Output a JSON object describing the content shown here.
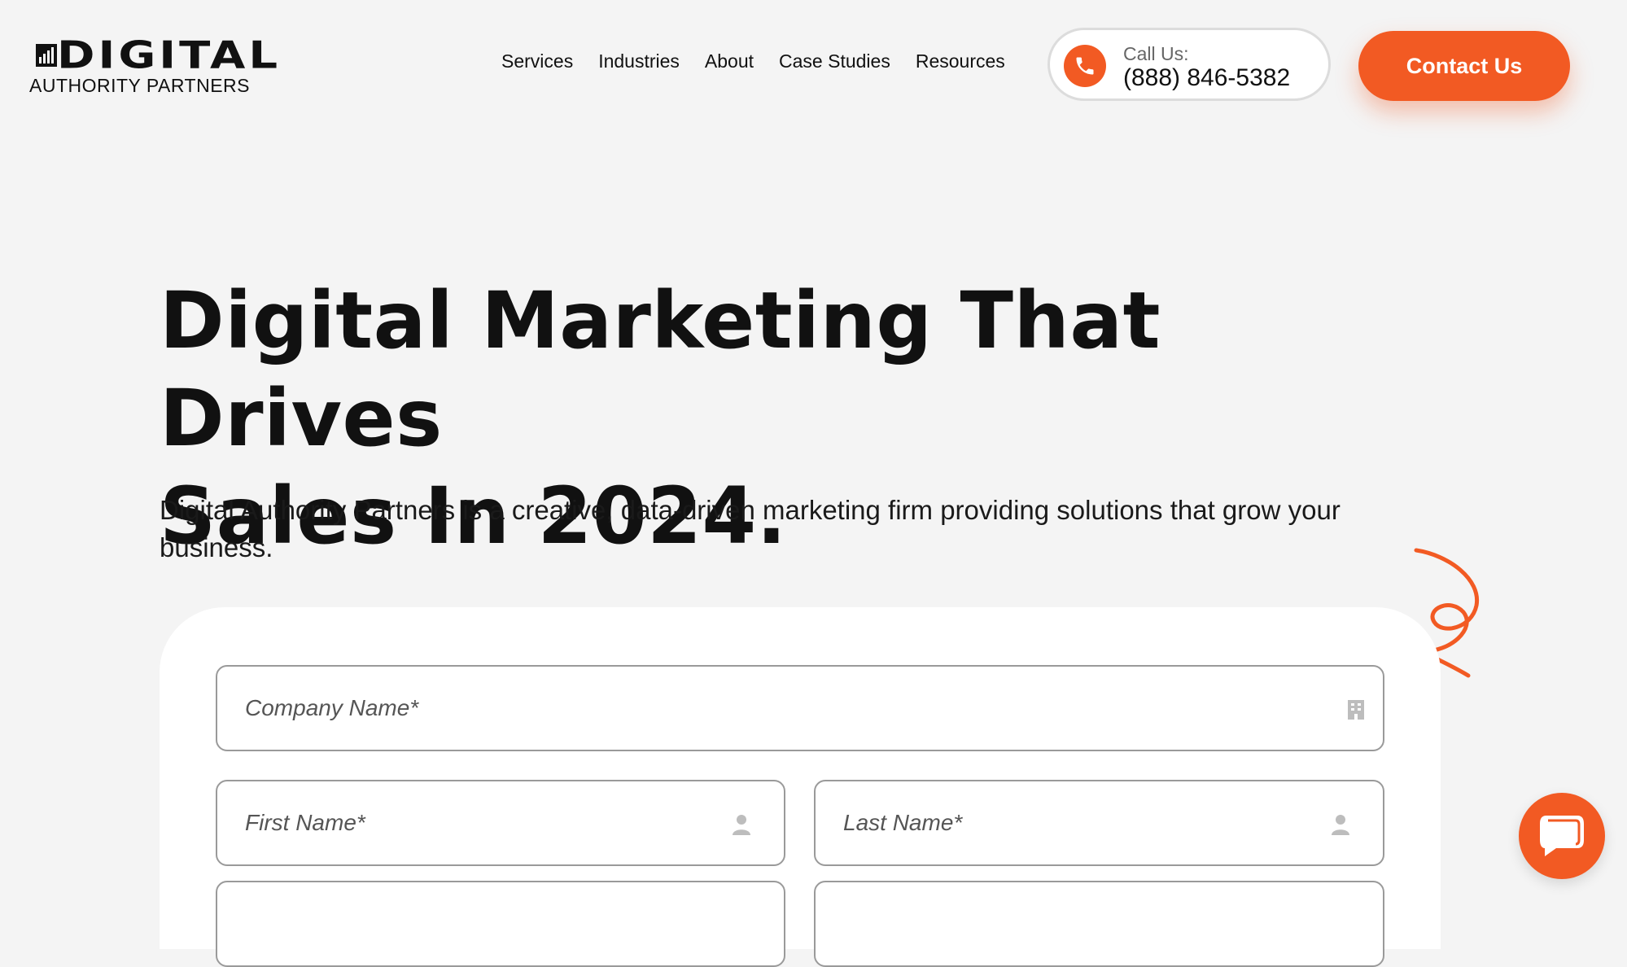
{
  "header": {
    "logo": {
      "word": "DIGITAL",
      "subtitle": "AUTHORITY PARTNERS"
    },
    "nav": [
      "Services",
      "Industries",
      "About",
      "Case Studies",
      "Resources"
    ],
    "call": {
      "label": "Call Us:",
      "number": "(888) 846-5382",
      "icon": "phone-icon"
    },
    "contact_label": "Contact Us"
  },
  "hero": {
    "title_line1": "Digital Marketing That Drives",
    "title_line2": "Sales In 2024.",
    "subtitle": "Digital Authority Partners is a creative, data-driven marketing firm providing solutions that grow your business."
  },
  "form": {
    "company_placeholder": "Company Name*",
    "first_name_placeholder": "First Name*",
    "last_name_placeholder": "Last Name*"
  },
  "icons": {
    "company": "building-icon",
    "person": "person-icon",
    "chat": "chat-icon"
  },
  "colors": {
    "accent": "#f25a23",
    "background": "#f4f4f4",
    "card": "#ffffff",
    "text": "#111111"
  }
}
